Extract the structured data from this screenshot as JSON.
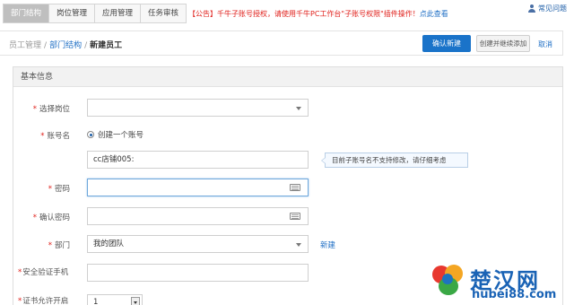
{
  "tabs": [
    {
      "label": "部门结构",
      "active": true
    },
    {
      "label": "岗位管理",
      "active": false
    },
    {
      "label": "应用管理",
      "active": false
    },
    {
      "label": "任务审核",
      "active": false
    }
  ],
  "notice": {
    "text": "【公告】千牛子账号授权，请使用千牛PC工作台\"子账号权限\"插件操作！",
    "link": "点此查看"
  },
  "faq": {
    "label": "常见问题",
    "icon": "user-help-icon"
  },
  "breadcrumb": {
    "items": [
      "员工管理",
      "部门结构",
      "新建员工"
    ],
    "separator": "/"
  },
  "actions": {
    "confirm": "确认新建",
    "create_continue": "创建并继续添加",
    "cancel": "取消"
  },
  "section": {
    "title": "基本信息"
  },
  "form": {
    "position": {
      "label": "选择岗位",
      "value": ""
    },
    "account": {
      "label": "账号名",
      "radio": "创建一个账号",
      "value": "cc店铺005:",
      "tip": "目前子账号名不支持修改，请仔细考虑"
    },
    "password": {
      "label": "密码",
      "value": ""
    },
    "confirm_password": {
      "label": "确认密码",
      "value": ""
    },
    "department": {
      "label": "部门",
      "value": "我的团队",
      "new_link": "新建"
    },
    "phone": {
      "label": "安全验证手机",
      "value": ""
    },
    "cert": {
      "label": "证书允许开启",
      "value": "1"
    }
  },
  "watermark": {
    "title": "楚汉网",
    "url": "hubei88.com"
  },
  "colors": {
    "primary": "#1a73c9",
    "required": "#e0211c",
    "link": "#1f6fc5"
  }
}
